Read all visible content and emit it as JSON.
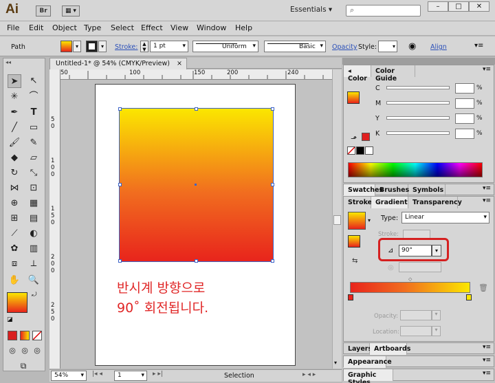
{
  "app": {
    "logo": "Ai",
    "bridge_badge": "Br",
    "workspace": "Essentials",
    "window_controls": [
      "–",
      "□",
      "✕"
    ]
  },
  "menu": [
    "File",
    "Edit",
    "Object",
    "Type",
    "Select",
    "Effect",
    "View",
    "Window",
    "Help"
  ],
  "control_bar": {
    "selection_type": "Path",
    "stroke_label": "Stroke:",
    "stroke_weight": "1 pt",
    "stroke_profile": "Uniform",
    "brush": "Basic",
    "opacity_label": "Opacity",
    "style_label": "Style:",
    "align_label": "Align"
  },
  "document": {
    "tab_title": "Untitled-1* @ 54% (CMYK/Preview)",
    "ruler_h_labels": [
      "50",
      "100",
      "150",
      "200",
      "240"
    ],
    "ruler_v_labels": [
      "5 0",
      "1 0 0",
      "1 5 0",
      "2 0 0",
      "2 5 0"
    ],
    "annotation_line1": "반시계 방향으로",
    "annotation_line2": "90˚ 회전됩니다."
  },
  "status": {
    "zoom": "54%",
    "artboard_number": "1",
    "tool_name": "Selection"
  },
  "color_panel": {
    "tabs": [
      "Color",
      "Color Guide"
    ],
    "channels": [
      "C",
      "M",
      "Y",
      "K"
    ]
  },
  "mid_panel": {
    "tabs": [
      "Swatches",
      "Brushes",
      "Symbols"
    ]
  },
  "gradient_panel": {
    "tabs": [
      "Stroke",
      "Gradient",
      "Transparency"
    ],
    "type_label": "Type:",
    "type_value": "Linear",
    "stroke_label": "Stroke:",
    "angle_value": "90°",
    "opacity_label": "Opacity:",
    "location_label": "Location:"
  },
  "bottom_panels": {
    "layers_tabs": [
      "Layers",
      "Artboards"
    ],
    "appearance": "Appearance",
    "graphic_styles": "Graphic Styles"
  },
  "colors": {
    "accent_red": "#e02626",
    "gradient_start": "#e8241c",
    "gradient_end": "#fbe700"
  }
}
